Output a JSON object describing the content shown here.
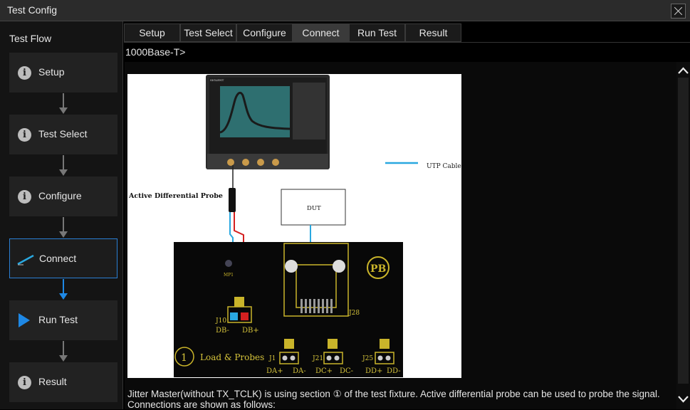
{
  "window": {
    "title": "Test Config"
  },
  "sidebar": {
    "title": "Test Flow",
    "steps": [
      {
        "label": "Setup",
        "icon": "info-icon"
      },
      {
        "label": "Test Select",
        "icon": "info-icon"
      },
      {
        "label": "Configure",
        "icon": "info-icon"
      },
      {
        "label": "Connect",
        "icon": "probe-icon",
        "active": true
      },
      {
        "label": "Run Test",
        "icon": "play-icon"
      },
      {
        "label": "Result",
        "icon": "info-icon"
      }
    ]
  },
  "tabs": [
    {
      "label": "Setup"
    },
    {
      "label": "Test Select"
    },
    {
      "label": "Configure"
    },
    {
      "label": "Connect",
      "active": true
    },
    {
      "label": "Run Test"
    },
    {
      "label": "Result"
    }
  ],
  "breadcrumb": "1000Base-T>",
  "diagram": {
    "legend_label": "UTP Cable",
    "probe_label": "Active Differential Probe",
    "dut_label": "DUT",
    "section_number": "1",
    "section_label": "Load & Probes",
    "connectors": {
      "j10": "J10",
      "j28": "J28",
      "j1": "J1",
      "j21": "J21",
      "j25": "J25",
      "mp1": "MP1",
      "pb_logo": "PB"
    },
    "pins": {
      "j10": [
        "DB-",
        "DB+"
      ],
      "j1": [
        "DA+",
        "DA-"
      ],
      "j21": [
        "DC+",
        "DC-"
      ],
      "j25": [
        "DD+",
        "DD-"
      ]
    },
    "scope_brand": "SIGLENT"
  },
  "description": "Jitter Master(without TX_TCLK) is using section ① of the test fixture. Active differential probe can be used to probe the signal. Connections are shown as follows:",
  "colors": {
    "accent": "#1e88e5",
    "cable_blue": "#29a8e0",
    "wire_red": "#d42020"
  }
}
